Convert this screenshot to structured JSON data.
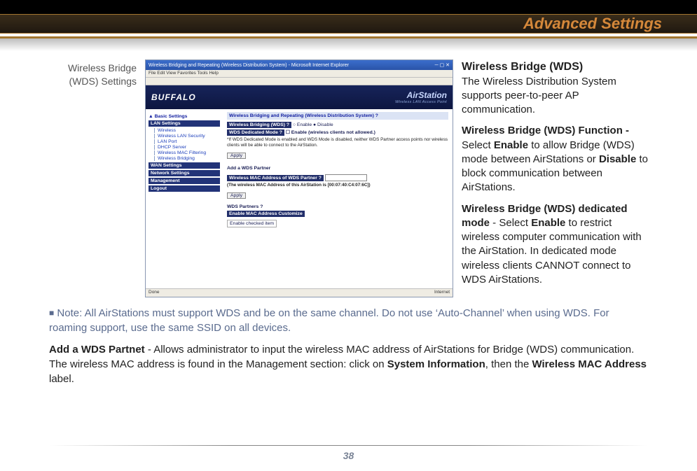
{
  "header": {
    "title": "Advanced Settings"
  },
  "page_number": "38",
  "left_caption": "Wireless Bridge (WDS) Settings",
  "screenshot": {
    "window_title": "Wireless Bridging and Repeating (Wireless Distribution System) - Microsoft Internet Explorer",
    "menu": "File   Edit   View   Favorites   Tools   Help",
    "brand_left": "BUFFALO",
    "brand_right": "AirStation",
    "brand_sub": "Wireless LAN Access Point",
    "sidebar": {
      "basic": "▲ Basic Settings",
      "lan_hdr": "LAN Settings",
      "items": [
        "Wireless",
        "Wireless LAN Security",
        "LAN Port",
        "DHCP Server",
        "Wireless MAC Filtering",
        "Wireless Bridging"
      ],
      "wan": "WAN Settings",
      "network": "Network Settings",
      "mgmt": "Management",
      "logout": "Logout"
    },
    "main": {
      "title": "Wireless Bridging and Repeating (Wireless Distribution System)  ?",
      "row1_label": "Wireless Bridging (WDS)  ?",
      "row1_opts": "○ Enable   ● Disable",
      "row2_label": "WDS Dedicated Mode  ?",
      "row2_opts": "☐ Enable (wireless clients not allowed.)",
      "row2_note": "*If WDS Dedicated Mode is enabled and WDS Mode is disabled, neither WDS Partner access points nor wireless clients will be able to connect to the AirStation.",
      "apply": "Apply",
      "section2_title": "Add a WDS Partner",
      "row3_label": "Wireless MAC Address of WDS Partner  ?",
      "row3_note": "(The wireless MAC Address of this AirStation is [00:07:40:C4:07:6C])",
      "section3_title": "WDS Partners  ?",
      "table_hdr": "Enable MAC Address Customize",
      "table_row": "Enable checked item"
    },
    "status_left": "Done",
    "status_right": "Internet"
  },
  "right": {
    "h1": "Wireless Bridge (WDS)",
    "p1": "The Wireless Distribution System supports peer-to-peer AP communication.",
    "p2a": "Wireless Bridge (WDS) Function - ",
    "p2b": "Select ",
    "p2c": "Enable",
    "p2d": " to allow Bridge (WDS) mode between AirStations or ",
    "p2e": "Disable",
    "p2f": " to block communication between AirStations.",
    "p3a": "Wireless Bridge (WDS) dedicated mode",
    "p3b": " - Select ",
    "p3c": "Enable",
    "p3d": " to restrict wireless computer communication with the AirStation. In dedicated mode wireless clients CANNOT connect to WDS AirStations."
  },
  "lower": {
    "note": "Note: All AirStations must support WDS and be on the same channel.  Do not use ‘Auto-Channel’ when using WDS.  For roaming support, use the same SSID on all devices.",
    "p1a": "Add a WDS Partnet",
    "p1b": " - Allows administrator to input the wireless MAC address of AirStations for Bridge (WDS) communication. The wireless MAC address  is found in the Management section: click on ",
    "p1c": "System Information",
    "p1d": ", then the ",
    "p1e": "Wireless MAC Address",
    "p1f": " label."
  }
}
